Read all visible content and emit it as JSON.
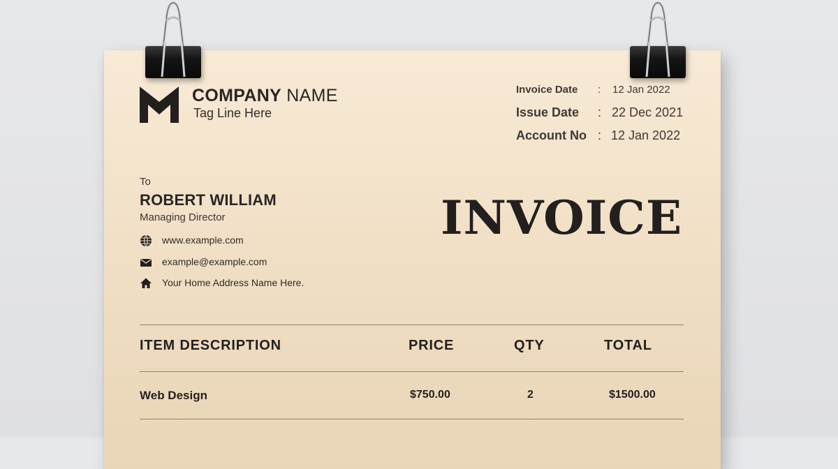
{
  "company": {
    "name_bold": "COMPANY",
    "name_rest": "NAME",
    "tagline": "Tag Line Here"
  },
  "meta": [
    {
      "label": "Invoice Date",
      "colon": ":",
      "value": "12 Jan 2022"
    },
    {
      "label": "Issue Date",
      "colon": ":",
      "value": "22 Dec 2021"
    },
    {
      "label": "Account No",
      "colon": ":",
      "value": "12 Jan 2022"
    }
  ],
  "recipient": {
    "to_label": "To",
    "name": "ROBERT WILLIAM",
    "role": "Managing Director",
    "website": "www.example.com",
    "email": "example@example.com",
    "address": "Your Home Address Name Here."
  },
  "title": "INVOICE",
  "table": {
    "headers": [
      "ITEM DESCRIPTION",
      "PRICE",
      "QTY",
      "TOTAL"
    ],
    "rows": [
      {
        "description": "Web Design",
        "price": "$750.00",
        "qty": "2",
        "total": "$1500.00"
      }
    ]
  },
  "icons": {
    "logo": "m-logo-icon",
    "website": "globe-icon",
    "email": "envelope-icon",
    "address": "home-icon",
    "clip": "binder-clip-icon"
  },
  "colors": {
    "paper": "#f3e3cb",
    "ink": "#231f1e",
    "background": "#e4e5e7"
  }
}
